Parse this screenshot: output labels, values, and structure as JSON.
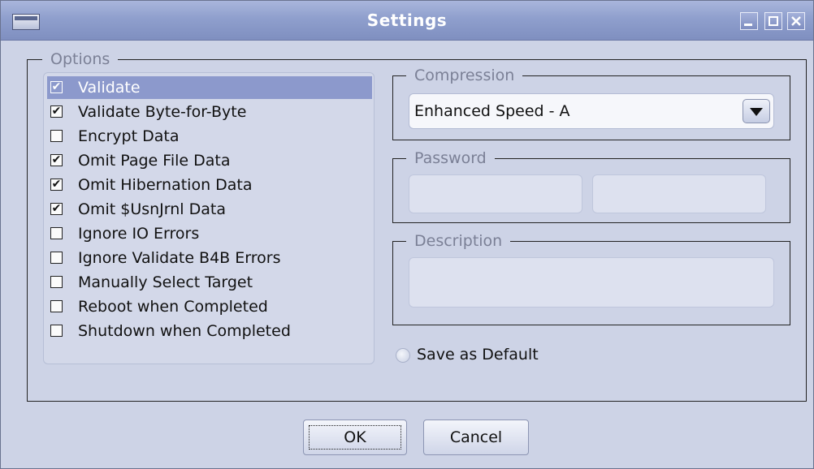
{
  "window": {
    "title": "Settings",
    "controls": [
      "minimize-icon",
      "maximize-icon",
      "close-icon"
    ]
  },
  "options": {
    "legend": "Options",
    "items": [
      {
        "label": "Validate",
        "checked": true,
        "selected": true
      },
      {
        "label": "Validate Byte-for-Byte",
        "checked": true,
        "selected": false
      },
      {
        "label": "Encrypt Data",
        "checked": false,
        "selected": false
      },
      {
        "label": "Omit Page File Data",
        "checked": true,
        "selected": false
      },
      {
        "label": "Omit Hibernation Data",
        "checked": true,
        "selected": false
      },
      {
        "label": "Omit $UsnJrnl Data",
        "checked": true,
        "selected": false
      },
      {
        "label": "Ignore IO Errors",
        "checked": false,
        "selected": false
      },
      {
        "label": "Ignore Validate B4B Errors",
        "checked": false,
        "selected": false
      },
      {
        "label": "Manually Select Target",
        "checked": false,
        "selected": false
      },
      {
        "label": "Reboot when Completed",
        "checked": false,
        "selected": false
      },
      {
        "label": "Shutdown when Completed",
        "checked": false,
        "selected": false
      }
    ]
  },
  "compression": {
    "legend": "Compression",
    "selected": "Enhanced Speed - A"
  },
  "password": {
    "legend": "Password",
    "value1": "",
    "value2": ""
  },
  "description": {
    "legend": "Description",
    "value": ""
  },
  "save_default": {
    "label": "Save as Default",
    "checked": false
  },
  "buttons": {
    "ok": "OK",
    "cancel": "Cancel"
  },
  "colors": {
    "titlebar": "#8f9fcd",
    "background": "#cdd3e6",
    "selection": "#8c99cc"
  }
}
